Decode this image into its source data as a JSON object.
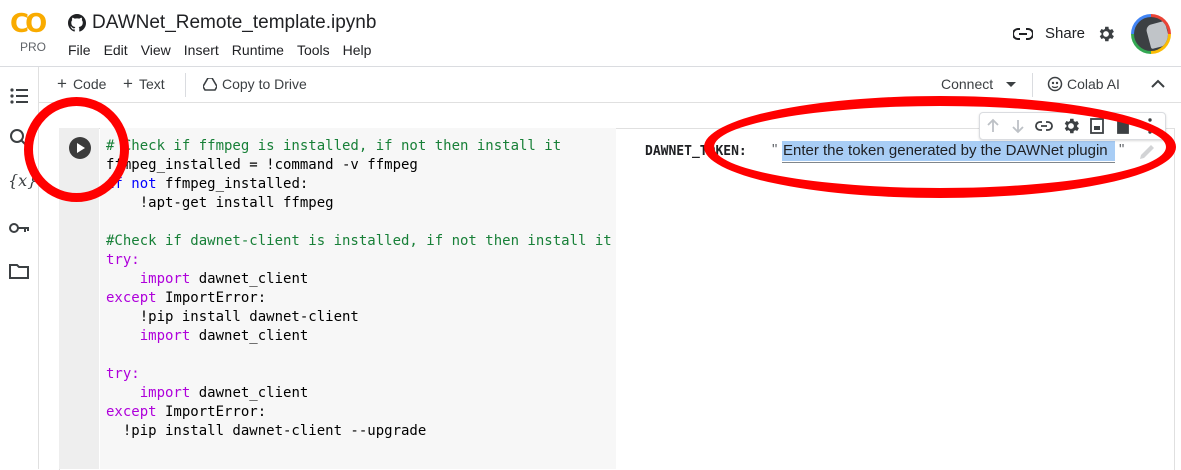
{
  "header": {
    "logo_text": "CO",
    "logo_badge": "PRO",
    "title": "DAWNet_Remote_template.ipynb",
    "menu": [
      "File",
      "Edit",
      "View",
      "Insert",
      "Runtime",
      "Tools",
      "Help"
    ],
    "share_label": "Share"
  },
  "toolbar": {
    "add_code": "Code",
    "add_text": "Text",
    "copy_to_drive": "Copy to Drive",
    "connect": "Connect",
    "colab_ai": "Colab AI"
  },
  "rail_icons": [
    "table-of-contents-icon",
    "search-icon",
    "variables-icon",
    "secrets-key-icon",
    "files-folder-icon"
  ],
  "cell": {
    "code_lines": [
      "# Check if ffmpeg is installed, if not then install it",
      "ffmpeg_installed = !command -v ffmpeg",
      "if not ffmpeg_installed:",
      "    !apt-get install ffmpeg",
      "",
      "#Check if dawnet-client is installed, if not then install it",
      "try:",
      "    import dawnet_client",
      "except ImportError:",
      "    !pip install dawnet-client",
      "    import dawnet_client",
      "",
      "try:",
      "    import dawnet_client",
      "except ImportError:",
      "  !pip install dawnet-client --upgrade"
    ],
    "form": {
      "label": "DAWNET_TOKEN:",
      "open_quote": "\"",
      "value": "Enter the token generated by the DAWNet plugin",
      "close_quote": "\""
    }
  },
  "colors": {
    "annotation_ring": "#ff0000",
    "selection": "#a8cdf5",
    "comment": "#188038",
    "keyword": "#0000ff",
    "import_keyword": "#af00db"
  }
}
